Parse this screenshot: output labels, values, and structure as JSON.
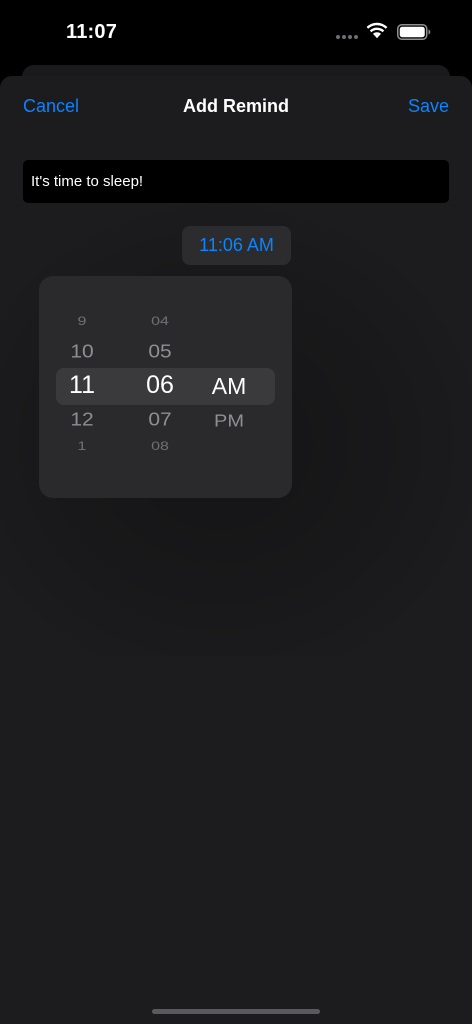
{
  "status_bar": {
    "time": "11:07"
  },
  "nav": {
    "cancel_label": "Cancel",
    "title": "Add Remind",
    "save_label": "Save"
  },
  "reminder": {
    "text_value": "It's time to sleep!"
  },
  "time_chip": {
    "value": "11:06 AM"
  },
  "picker": {
    "hours": [
      "9",
      "10",
      "11",
      "12",
      "1"
    ],
    "selected_hour": "11",
    "minutes": [
      "04",
      "05",
      "06",
      "07",
      "08"
    ],
    "selected_minute": "06",
    "periods": [
      "AM",
      "PM"
    ],
    "selected_period": "AM"
  },
  "colors": {
    "accent": "#0a84ff",
    "sheet_background": "#1c1c1e",
    "picker_background": "#2a2a2c",
    "selection_band": "#3a3a3c",
    "secondary_text": "#8e8e93"
  }
}
